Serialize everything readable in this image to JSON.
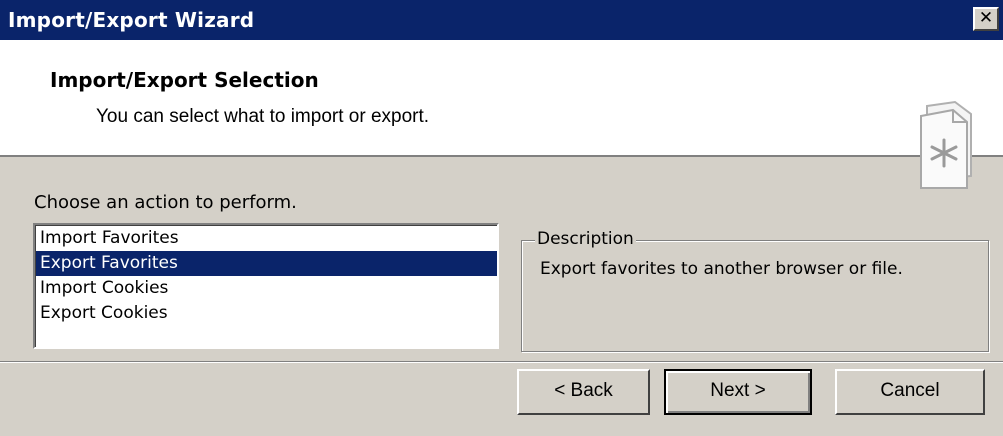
{
  "window": {
    "title": "Import/Export Wizard",
    "close_symbol": "✕"
  },
  "header": {
    "title": "Import/Export Selection",
    "subtitle": "You can select what to import or export.",
    "icon": "wizard-document-icon"
  },
  "main": {
    "prompt": "Choose an action to perform.",
    "actions": [
      {
        "label": "Import Favorites",
        "selected": false
      },
      {
        "label": "Export Favorites",
        "selected": true
      },
      {
        "label": "Import Cookies",
        "selected": false
      },
      {
        "label": "Export Cookies",
        "selected": false
      }
    ],
    "description": {
      "legend": "Description",
      "text": "Export favorites to another browser or file."
    }
  },
  "buttons": {
    "back": "< Back",
    "next": "Next >",
    "cancel": "Cancel"
  },
  "colors": {
    "title_bar": "#0a246a",
    "selection": "#0a246a",
    "dialog_face": "#d4d0c8"
  }
}
